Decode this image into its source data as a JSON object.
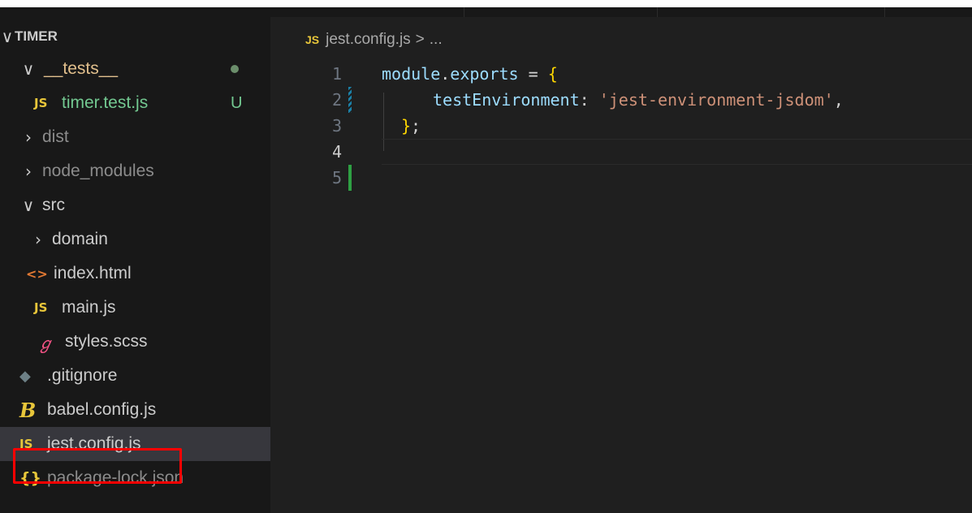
{
  "explorer": {
    "root_label": "TIMER",
    "items": [
      {
        "label": "__tests__",
        "chevron": "∨",
        "icon": "",
        "status": "modified-dot"
      },
      {
        "label": "timer.test.js",
        "chevron": "",
        "icon": "JS",
        "status": "U"
      },
      {
        "label": "dist",
        "chevron": ">",
        "icon": ""
      },
      {
        "label": "node_modules",
        "chevron": ">",
        "icon": ""
      },
      {
        "label": "src",
        "chevron": "∨",
        "icon": ""
      },
      {
        "label": "domain",
        "chevron": ">",
        "icon": ""
      },
      {
        "label": "index.html",
        "chevron": "",
        "icon": "<>"
      },
      {
        "label": "main.js",
        "chevron": "",
        "icon": "JS"
      },
      {
        "label": "styles.scss",
        "chevron": "",
        "icon": "ℊ"
      },
      {
        "label": ".gitignore",
        "chevron": "",
        "icon": "◆"
      },
      {
        "label": "babel.config.js",
        "chevron": "",
        "icon": "B"
      },
      {
        "label": "jest.config.js",
        "chevron": "",
        "icon": "JS"
      },
      {
        "label": "package-lock.json",
        "chevron": "",
        "icon": "{}"
      }
    ]
  },
  "breadcrumb": {
    "icon": "JS",
    "file": "jest.config.js",
    "separator": ">",
    "rest": "..."
  },
  "editor": {
    "line_numbers": [
      "1",
      "2",
      "3",
      "4",
      "5"
    ],
    "lines": {
      "l1_var": "module",
      "l1_dot": ".",
      "l1_prop": "exports",
      "l1_op": " = ",
      "l1_brace": "{",
      "l2_key": "testEnvironment",
      "l2_colon": ": ",
      "l2_str": "'jest-environment-jsdom'",
      "l2_comma": ",",
      "l3_brace": "}",
      "l3_semi": ";"
    }
  },
  "colors": {
    "sidebar_bg": "#181818",
    "editor_bg": "#1f1f1f",
    "highlight_border": "#ff0000",
    "gutter_modified": "#1b81a8",
    "gutter_added": "#2ea043"
  }
}
